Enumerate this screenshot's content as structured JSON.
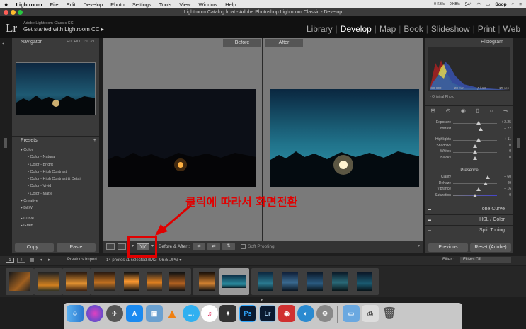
{
  "menubar": {
    "apple": "",
    "app": "Lightroom",
    "items": [
      "File",
      "Edit",
      "Develop",
      "Photo",
      "Settings",
      "Tools",
      "View",
      "Window",
      "Help"
    ],
    "net_up": "0 KB/s",
    "net_down": "0 KB/s",
    "temp": "54°",
    "user": "Soop"
  },
  "window": {
    "title": "Lightroom Catalog.lrcat - Adobe Photoshop Lightroom Classic - Develop"
  },
  "identity": {
    "logo": "Lr",
    "line1": "Adobe Lightroom Classic CC",
    "line2": "Get started with Lightroom CC ▸"
  },
  "modules": [
    "Library",
    "Develop",
    "Map",
    "Book",
    "Slideshow",
    "Print",
    "Web"
  ],
  "active_module": "Develop",
  "navigator": {
    "title": "Navigator",
    "zoom": [
      "FIT",
      "FILL",
      "1:1",
      "3:1"
    ]
  },
  "presets": {
    "title": "Presets",
    "groups": [
      {
        "name": "Color",
        "items": [
          "Color - Natural",
          "Color - Bright",
          "Color - High Contrast",
          "Color - High Contrast & Detail",
          "Color - Vivid",
          "Color - Matte"
        ]
      },
      {
        "name": "Creative"
      },
      {
        "name": "B&W"
      },
      {
        "name": "Curve"
      },
      {
        "name": "Grain"
      }
    ]
  },
  "left_buttons": {
    "copy": "Copy...",
    "paste": "Paste"
  },
  "compare": {
    "before": "Before",
    "after": "After"
  },
  "toolbar": {
    "before_after": "Before & After :",
    "soft_proofing": "Soft Proofing",
    "view_icon_text": "Y|Y"
  },
  "histogram": {
    "title": "Histogram",
    "iso": "ISO 800",
    "focal": "28 mm",
    "aperture": "ƒ / 4.0",
    "shutter": "1⁄6 sec",
    "original": "Original Photo"
  },
  "basic": [
    {
      "name": "Exposure",
      "value": "+ 2.25"
    },
    {
      "name": "Contrast",
      "value": "+ 22"
    },
    {
      "name": "Highlights",
      "value": "+ 11"
    },
    {
      "name": "Shadows",
      "value": "0"
    },
    {
      "name": "Whites",
      "value": "0"
    },
    {
      "name": "Blacks",
      "value": "0"
    }
  ],
  "presence": {
    "title": "Presence",
    "sliders": [
      {
        "name": "Clarity",
        "value": "+ 60"
      },
      {
        "name": "Dehaze",
        "value": "+ 49"
      },
      {
        "name": "Vibrance",
        "value": "+ 16"
      },
      {
        "name": "Saturation",
        "value": "0"
      }
    ]
  },
  "right_sections": [
    "Tone Curve",
    "HSL / Color",
    "Split Toning"
  ],
  "right_buttons": {
    "previous": "Previous",
    "reset": "Reset (Adobe)"
  },
  "filmstrip": {
    "source": "Previous Import",
    "count": "14 photos /1 selected /IMG_9675.JPG ▾",
    "filter_label": "Filter :",
    "filter_value": "Filters Off"
  },
  "annotation": "클릭에 따라서 화면전환",
  "dock": [
    "Finder",
    "Siri",
    "Launchpad",
    "App Store",
    "Preview",
    "VLC",
    "Messages",
    "iTunes",
    "Final Cut",
    "Ps",
    "Lr",
    "Photo Booth",
    "Screen Saver",
    "System Preferences",
    "Downloads",
    "Printer",
    "Trash"
  ]
}
